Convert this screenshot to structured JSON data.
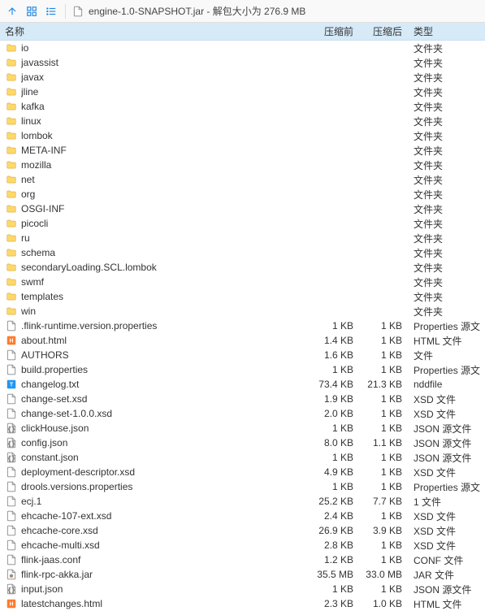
{
  "toolbar": {
    "title": "engine-1.0-SNAPSHOT.jar - 解包大小为 276.9 MB"
  },
  "headers": {
    "name": "名称",
    "compressed_before": "压缩前",
    "compressed_after": "压缩后",
    "type": "类型"
  },
  "types": {
    "folder": "文件夹",
    "props": "Properties 源文件",
    "html": "HTML 文件",
    "file": "文件",
    "ndd": "nddfile",
    "xsd": "XSD 文件",
    "json": "JSON 源文件",
    "one": "1 文件",
    "conf": "CONF 文件",
    "jar": "JAR 文件"
  },
  "rows": [
    {
      "icon": "folder",
      "name": "io",
      "s1": "",
      "s2": "",
      "type": "folder"
    },
    {
      "icon": "folder",
      "name": "javassist",
      "s1": "",
      "s2": "",
      "type": "folder"
    },
    {
      "icon": "folder",
      "name": "javax",
      "s1": "",
      "s2": "",
      "type": "folder"
    },
    {
      "icon": "folder",
      "name": "jline",
      "s1": "",
      "s2": "",
      "type": "folder"
    },
    {
      "icon": "folder",
      "name": "kafka",
      "s1": "",
      "s2": "",
      "type": "folder"
    },
    {
      "icon": "folder",
      "name": "linux",
      "s1": "",
      "s2": "",
      "type": "folder"
    },
    {
      "icon": "folder",
      "name": "lombok",
      "s1": "",
      "s2": "",
      "type": "folder"
    },
    {
      "icon": "folder",
      "name": "META-INF",
      "s1": "",
      "s2": "",
      "type": "folder"
    },
    {
      "icon": "folder",
      "name": "mozilla",
      "s1": "",
      "s2": "",
      "type": "folder"
    },
    {
      "icon": "folder",
      "name": "net",
      "s1": "",
      "s2": "",
      "type": "folder"
    },
    {
      "icon": "folder",
      "name": "org",
      "s1": "",
      "s2": "",
      "type": "folder"
    },
    {
      "icon": "folder",
      "name": "OSGI-INF",
      "s1": "",
      "s2": "",
      "type": "folder"
    },
    {
      "icon": "folder",
      "name": "picocli",
      "s1": "",
      "s2": "",
      "type": "folder"
    },
    {
      "icon": "folder",
      "name": "ru",
      "s1": "",
      "s2": "",
      "type": "folder"
    },
    {
      "icon": "folder",
      "name": "schema",
      "s1": "",
      "s2": "",
      "type": "folder"
    },
    {
      "icon": "folder",
      "name": "secondaryLoading.SCL.lombok",
      "s1": "",
      "s2": "",
      "type": "folder"
    },
    {
      "icon": "folder",
      "name": "swmf",
      "s1": "",
      "s2": "",
      "type": "folder"
    },
    {
      "icon": "folder",
      "name": "templates",
      "s1": "",
      "s2": "",
      "type": "folder"
    },
    {
      "icon": "folder",
      "name": "win",
      "s1": "",
      "s2": "",
      "type": "folder"
    },
    {
      "icon": "file",
      "name": ".flink-runtime.version.properties",
      "s1": "1 KB",
      "s2": "1 KB",
      "type": "props"
    },
    {
      "icon": "html",
      "name": "about.html",
      "s1": "1.4 KB",
      "s2": "1 KB",
      "type": "html"
    },
    {
      "icon": "file",
      "name": "AUTHORS",
      "s1": "1.6 KB",
      "s2": "1 KB",
      "type": "file"
    },
    {
      "icon": "file",
      "name": "build.properties",
      "s1": "1 KB",
      "s2": "1 KB",
      "type": "props"
    },
    {
      "icon": "txt",
      "name": "changelog.txt",
      "s1": "73.4 KB",
      "s2": "21.3 KB",
      "type": "ndd"
    },
    {
      "icon": "file",
      "name": "change-set.xsd",
      "s1": "1.9 KB",
      "s2": "1 KB",
      "type": "xsd"
    },
    {
      "icon": "file",
      "name": "change-set-1.0.0.xsd",
      "s1": "2.0 KB",
      "s2": "1 KB",
      "type": "xsd"
    },
    {
      "icon": "json",
      "name": "clickHouse.json",
      "s1": "1 KB",
      "s2": "1 KB",
      "type": "json"
    },
    {
      "icon": "json",
      "name": "config.json",
      "s1": "8.0 KB",
      "s2": "1.1 KB",
      "type": "json"
    },
    {
      "icon": "json",
      "name": "constant.json",
      "s1": "1 KB",
      "s2": "1 KB",
      "type": "json"
    },
    {
      "icon": "file",
      "name": "deployment-descriptor.xsd",
      "s1": "4.9 KB",
      "s2": "1 KB",
      "type": "xsd"
    },
    {
      "icon": "file",
      "name": "drools.versions.properties",
      "s1": "1 KB",
      "s2": "1 KB",
      "type": "props"
    },
    {
      "icon": "file",
      "name": "ecj.1",
      "s1": "25.2 KB",
      "s2": "7.7 KB",
      "type": "one"
    },
    {
      "icon": "file",
      "name": "ehcache-107-ext.xsd",
      "s1": "2.4 KB",
      "s2": "1 KB",
      "type": "xsd"
    },
    {
      "icon": "file",
      "name": "ehcache-core.xsd",
      "s1": "26.9 KB",
      "s2": "3.9 KB",
      "type": "xsd"
    },
    {
      "icon": "file",
      "name": "ehcache-multi.xsd",
      "s1": "2.8 KB",
      "s2": "1 KB",
      "type": "xsd"
    },
    {
      "icon": "file",
      "name": "flink-jaas.conf",
      "s1": "1.2 KB",
      "s2": "1 KB",
      "type": "conf"
    },
    {
      "icon": "jar",
      "name": "flink-rpc-akka.jar",
      "s1": "35.5 MB",
      "s2": "33.0 MB",
      "type": "jar"
    },
    {
      "icon": "json",
      "name": "input.json",
      "s1": "1 KB",
      "s2": "1 KB",
      "type": "json"
    },
    {
      "icon": "html",
      "name": "latestchanges.html",
      "s1": "2.3 KB",
      "s2": "1.0 KB",
      "type": "html"
    }
  ]
}
